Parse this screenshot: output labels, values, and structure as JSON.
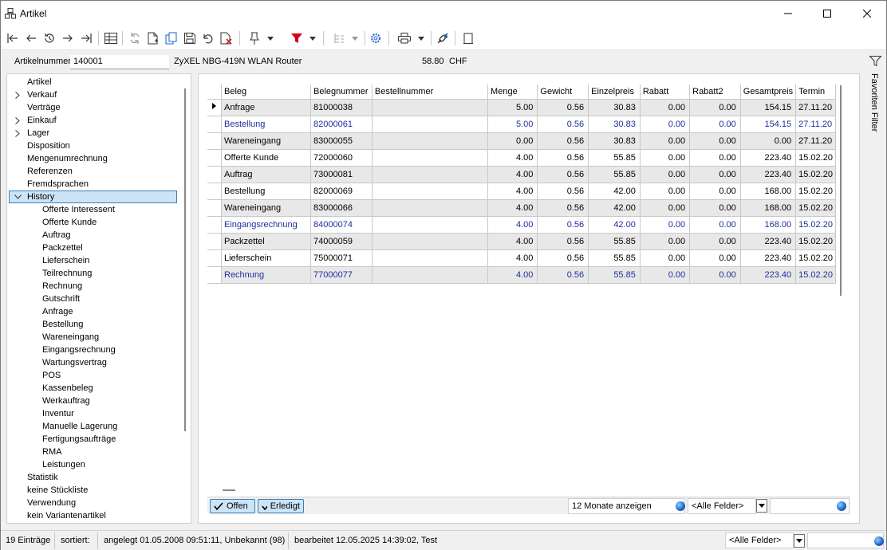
{
  "window": {
    "title": "Artikel"
  },
  "article": {
    "label": "Artikelnummer",
    "number": "140001",
    "name": "ZyXEL NBG-419N WLAN Router",
    "price": "58.80",
    "currency": "CHF"
  },
  "sidetab": {
    "label": "Favoriten Filter"
  },
  "tree": {
    "top": [
      {
        "label": "Artikel",
        "expandable": false
      },
      {
        "label": "Verkauf",
        "expandable": true
      },
      {
        "label": "Verträge",
        "expandable": false
      },
      {
        "label": "Einkauf",
        "expandable": true
      },
      {
        "label": "Lager",
        "expandable": true
      },
      {
        "label": "Disposition",
        "expandable": false
      },
      {
        "label": "Mengenumrechnung",
        "expandable": false
      },
      {
        "label": "Referenzen",
        "expandable": false
      },
      {
        "label": "Fremdsprachen",
        "expandable": false
      }
    ],
    "history": {
      "label": "History",
      "children": [
        "Offerte Interessent",
        "Offerte Kunde",
        "Auftrag",
        "Packzettel",
        "Lieferschein",
        "Teilrechnung",
        "Rechnung",
        "Gutschrift",
        "Anfrage",
        "Bestellung",
        "Wareneingang",
        "Eingangsrechnung",
        "Wartungsvertrag",
        "POS",
        "Kassenbeleg",
        "Werkauftrag",
        "Inventur",
        "Manuelle Lagerung",
        "Fertigungsaufträge",
        "RMA",
        "Leistungen"
      ]
    },
    "bottom": [
      "Statistik",
      "keine Stückliste",
      "Verwendung",
      "kein Variantenartikel"
    ]
  },
  "grid": {
    "columns": [
      "Beleg",
      "Belegnummer",
      "Bestellnummer",
      "Menge",
      "Gewicht",
      "Einzelpreis",
      "Rabatt",
      "Rabatt2",
      "Gesamtpreis",
      "Termin"
    ],
    "rows": [
      {
        "beleg": "Anfrage",
        "nr": "81000038",
        "best": "",
        "menge": "5.00",
        "gewicht": "0.56",
        "einzel": "30.83",
        "rabatt": "0.00",
        "rabatt2": "0.00",
        "gesamt": "154.15",
        "termin": "27.11.20",
        "blue": false,
        "shade": "g",
        "current": true
      },
      {
        "beleg": "Bestellung",
        "nr": "82000061",
        "best": "",
        "menge": "5.00",
        "gewicht": "0.56",
        "einzel": "30.83",
        "rabatt": "0.00",
        "rabatt2": "0.00",
        "gesamt": "154.15",
        "termin": "27.11.20",
        "blue": true,
        "shade": "w",
        "current": false
      },
      {
        "beleg": "Wareneingang",
        "nr": "83000055",
        "best": "",
        "menge": "0.00",
        "gewicht": "0.56",
        "einzel": "30.83",
        "rabatt": "0.00",
        "rabatt2": "0.00",
        "gesamt": "0.00",
        "termin": "27.11.20",
        "blue": false,
        "shade": "g",
        "current": false
      },
      {
        "beleg": "Offerte Kunde",
        "nr": "72000060",
        "best": "",
        "menge": "4.00",
        "gewicht": "0.56",
        "einzel": "55.85",
        "rabatt": "0.00",
        "rabatt2": "0.00",
        "gesamt": "223.40",
        "termin": "15.02.20",
        "blue": false,
        "shade": "w",
        "current": false
      },
      {
        "beleg": "Auftrag",
        "nr": "73000081",
        "best": "",
        "menge": "4.00",
        "gewicht": "0.56",
        "einzel": "55.85",
        "rabatt": "0.00",
        "rabatt2": "0.00",
        "gesamt": "223.40",
        "termin": "15.02.20",
        "blue": false,
        "shade": "g",
        "current": false
      },
      {
        "beleg": "Bestellung",
        "nr": "82000069",
        "best": "",
        "menge": "4.00",
        "gewicht": "0.56",
        "einzel": "42.00",
        "rabatt": "0.00",
        "rabatt2": "0.00",
        "gesamt": "168.00",
        "termin": "15.02.20",
        "blue": false,
        "shade": "w",
        "current": false
      },
      {
        "beleg": "Wareneingang",
        "nr": "83000066",
        "best": "",
        "menge": "4.00",
        "gewicht": "0.56",
        "einzel": "42.00",
        "rabatt": "0.00",
        "rabatt2": "0.00",
        "gesamt": "168.00",
        "termin": "15.02.20",
        "blue": false,
        "shade": "g",
        "current": false
      },
      {
        "beleg": "Eingangsrechnung",
        "nr": "84000074",
        "best": "",
        "menge": "4.00",
        "gewicht": "0.56",
        "einzel": "42.00",
        "rabatt": "0.00",
        "rabatt2": "0.00",
        "gesamt": "168.00",
        "termin": "15.02.20",
        "blue": true,
        "shade": "w",
        "current": false
      },
      {
        "beleg": "Packzettel",
        "nr": "74000059",
        "best": "",
        "menge": "4.00",
        "gewicht": "0.56",
        "einzel": "55.85",
        "rabatt": "0.00",
        "rabatt2": "0.00",
        "gesamt": "223.40",
        "termin": "15.02.20",
        "blue": false,
        "shade": "g",
        "current": false
      },
      {
        "beleg": "Lieferschein",
        "nr": "75000071",
        "best": "",
        "menge": "4.00",
        "gewicht": "0.56",
        "einzel": "55.85",
        "rabatt": "0.00",
        "rabatt2": "0.00",
        "gesamt": "223.40",
        "termin": "15.02.20",
        "blue": false,
        "shade": "w",
        "current": false
      },
      {
        "beleg": "Rechnung",
        "nr": "77000077",
        "best": "",
        "menge": "4.00",
        "gewicht": "0.56",
        "einzel": "55.85",
        "rabatt": "0.00",
        "rabatt2": "0.00",
        "gesamt": "223.40",
        "termin": "15.02.20",
        "blue": true,
        "shade": "g",
        "current": false
      }
    ]
  },
  "gridfoot": {
    "offen": "Offen",
    "erledigt": "Erledigt",
    "period": "12 Monate anzeigen",
    "fields": "<Alle Felder>",
    "search": ""
  },
  "status": {
    "count": "19 Einträge",
    "sorted": "sortiert:",
    "created": "angelegt 01.05.2008 09:51:11, Unbekannt (98)",
    "edited": "bearbeitet 12.05.2025 14:39:02, Test",
    "fields": "<Alle Felder>",
    "search": ""
  },
  "colors": {
    "selection": "#cce4f7",
    "selection_border": "#3c7fb1",
    "blue_text": "#1f2f9e",
    "filter_red": "#d0021b"
  }
}
